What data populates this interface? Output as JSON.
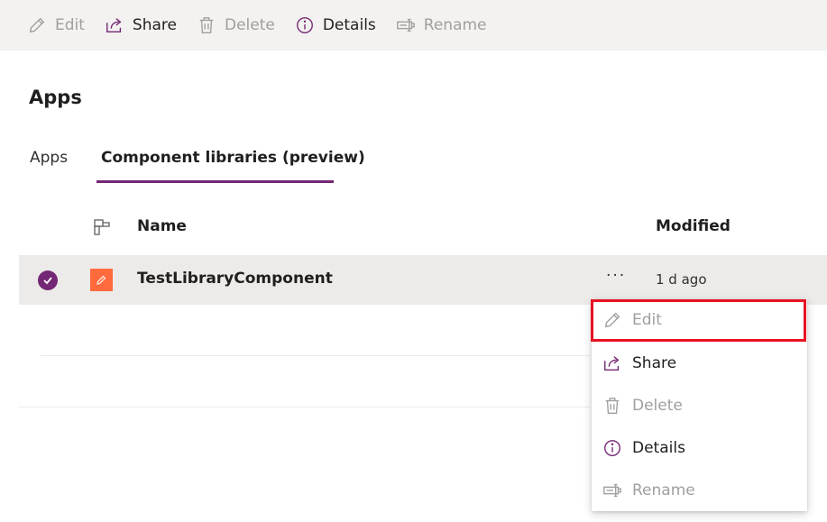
{
  "colors": {
    "accent": "#742774",
    "command_bar_bg": "#f3f2f1",
    "disabled_text": "#a19f9d",
    "selected_row_bg": "#edebe9",
    "app_icon_bg": "#ff6a3d",
    "highlight_border": "#e81123"
  },
  "toolbar": {
    "edit_label": "Edit",
    "share_label": "Share",
    "delete_label": "Delete",
    "details_label": "Details",
    "rename_label": "Rename"
  },
  "page": {
    "title": "Apps"
  },
  "tabs": [
    {
      "label": "Apps",
      "selected": false
    },
    {
      "label": "Component libraries (preview)",
      "selected": true
    }
  ],
  "list": {
    "columns": {
      "name": "Name",
      "modified": "Modified"
    },
    "rows": [
      {
        "name": "TestLibraryComponent",
        "modified": "1 d ago",
        "more_label": "···",
        "selected": true,
        "icon": "pencil-icon"
      }
    ]
  },
  "context_menu": {
    "items": [
      {
        "label": "Edit",
        "icon": "pencil-icon",
        "enabled": false,
        "highlighted": true
      },
      {
        "label": "Share",
        "icon": "share-icon",
        "enabled": true
      },
      {
        "label": "Delete",
        "icon": "trash-icon",
        "enabled": false
      },
      {
        "label": "Details",
        "icon": "info-icon",
        "enabled": true
      },
      {
        "label": "Rename",
        "icon": "rename-icon",
        "enabled": false
      }
    ]
  }
}
